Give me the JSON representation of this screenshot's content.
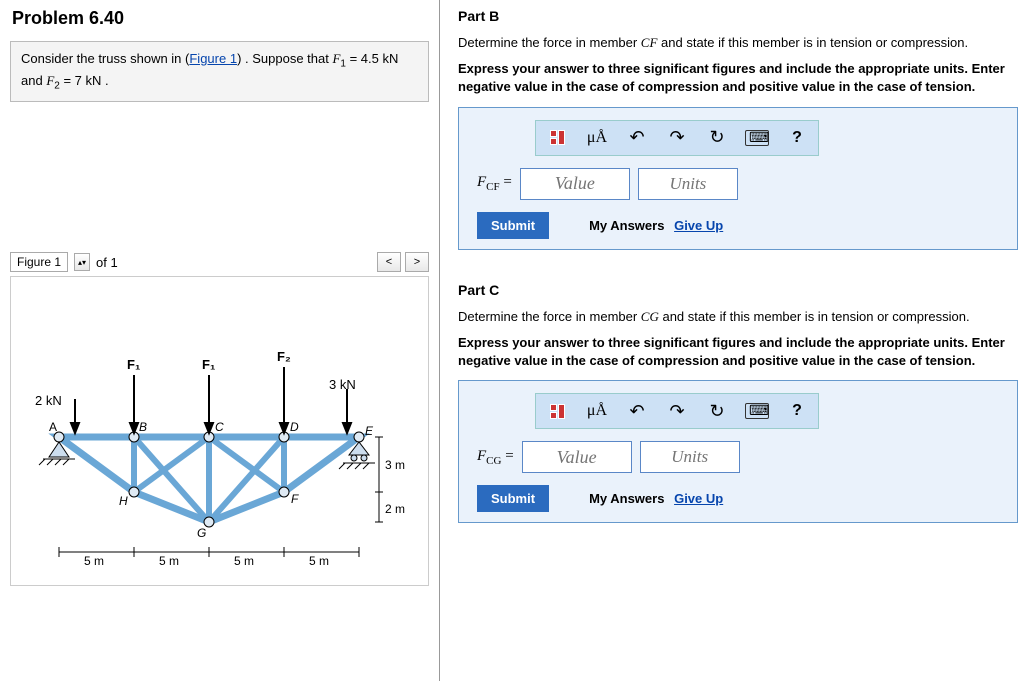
{
  "problem": {
    "title": "Problem 6.40",
    "context_pre": "Consider the truss shown in (",
    "figure_link": "Figure 1",
    "context_post": ") . Suppose that ",
    "F1": "F",
    "F1sub": "1",
    "F1eq": " = 4.5 kN",
    "and": " and ",
    "F2": "F",
    "F2sub": "2",
    "F2eq": " = 7 kN ."
  },
  "figure": {
    "label": "Figure 1",
    "of": "of 1",
    "prev": "<",
    "next": ">",
    "loads": {
      "left": "2 kN",
      "right": "3 kN",
      "F1": "F₁",
      "F1b": "F₁",
      "F2": "F₂"
    },
    "nodes": {
      "A": "A",
      "B": "B",
      "C": "C",
      "D": "D",
      "E": "E",
      "F": "F",
      "G": "G",
      "H": "H"
    },
    "dims": {
      "span": "5 m",
      "h1": "3 m",
      "h2": "2 m"
    }
  },
  "partB": {
    "title": "Part B",
    "q_pre": "Determine the force in member ",
    "member": "CF",
    "q_post": " and state if this member is in tension or compression.",
    "instr": "Express your answer to three significant figures and include the appropriate units. Enter negative value in the case of compression and positive value in the case of tension.",
    "mu": "μÅ",
    "label": "F",
    "labelsub": "CF",
    "labeleq": " =",
    "value_ph": "Value",
    "units_ph": "Units",
    "submit": "Submit",
    "myans": "My Answers",
    "giveup": "Give Up"
  },
  "partC": {
    "title": "Part C",
    "q_pre": "Determine the force in member ",
    "member": "CG",
    "q_post": " and state if this member is in tension or compression.",
    "instr": "Express your answer to three significant figures and include the appropriate units. Enter negative value in the case of compression and positive value in the case of tension.",
    "mu": "μÅ",
    "label": "F",
    "labelsub": "CG",
    "labeleq": " =",
    "value_ph": "Value",
    "units_ph": "Units",
    "submit": "Submit",
    "myans": "My Answers",
    "giveup": "Give Up"
  }
}
